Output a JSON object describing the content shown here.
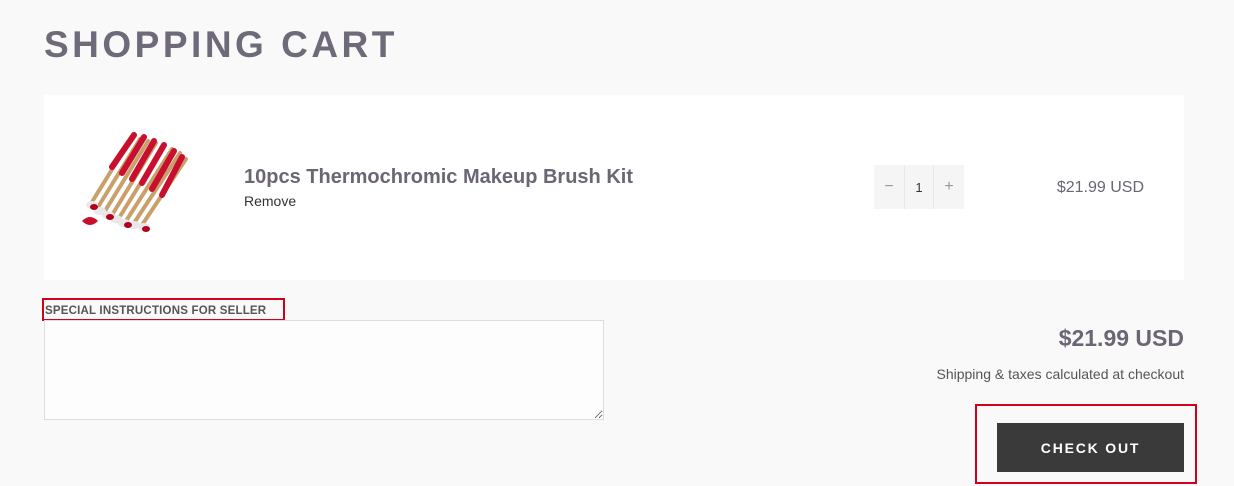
{
  "page": {
    "title": "SHOPPING CART"
  },
  "cart": {
    "items": [
      {
        "name": "10pcs Thermochromic Makeup Brush Kit",
        "remove_label": "Remove",
        "quantity": "1",
        "price": "$21.99 USD",
        "image_icon": "makeup-brush-set"
      }
    ],
    "qty_minus": "−",
    "qty_plus": "+"
  },
  "notes": {
    "label": "SPECIAL INSTRUCTIONS FOR SELLER",
    "value": ""
  },
  "summary": {
    "subtotal": "$21.99 USD",
    "shipping_note": "Shipping & taxes calculated at checkout",
    "checkout_label": "CHECK OUT"
  },
  "colors": {
    "background": "#f9f9f9",
    "title_text": "#6f6a79",
    "checkout_button": "#3a3a3a",
    "highlight_border": "#d0021b",
    "brush_red": "#c8102e",
    "brush_gold": "#c9a06a"
  }
}
